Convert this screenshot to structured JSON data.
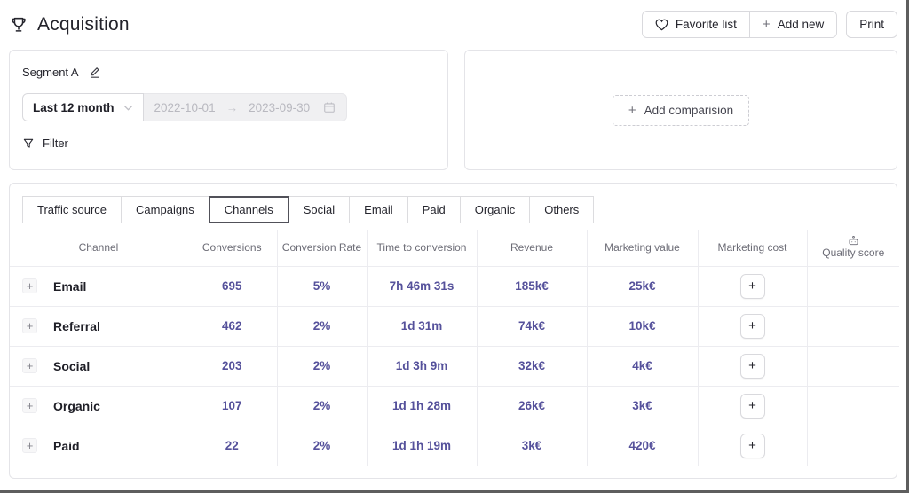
{
  "header": {
    "title": "Acquisition",
    "favorite_label": "Favorite list",
    "add_new_label": "Add new",
    "print_label": "Print"
  },
  "filters": {
    "segment_label": "Segment A",
    "period_value": "Last 12 month",
    "date_start": "2022-10-01",
    "date_arrow": "→",
    "date_end": "2023-09-30",
    "filter_label": "Filter"
  },
  "comparison": {
    "add_label": "Add comparision"
  },
  "tabs": [
    {
      "label": "Traffic source",
      "selected": false
    },
    {
      "label": "Campaigns",
      "selected": false
    },
    {
      "label": "Channels",
      "selected": true
    },
    {
      "label": "Social",
      "selected": false
    },
    {
      "label": "Email",
      "selected": false
    },
    {
      "label": "Paid",
      "selected": false
    },
    {
      "label": "Organic",
      "selected": false
    },
    {
      "label": "Others",
      "selected": false
    }
  ],
  "table": {
    "columns": [
      "Channel",
      "Conversions",
      "Conversion Rate",
      "Time to conversion",
      "Revenue",
      "Marketing value",
      "Marketing cost",
      "Quality score"
    ],
    "rows": [
      {
        "channel": "Email",
        "conversions": "695",
        "conversion_rate": "5%",
        "time_to_conversion": "7h 46m 31s",
        "revenue": "185k€",
        "marketing_value": "25k€"
      },
      {
        "channel": "Referral",
        "conversions": "462",
        "conversion_rate": "2%",
        "time_to_conversion": "1d 31m",
        "revenue": "74k€",
        "marketing_value": "10k€"
      },
      {
        "channel": "Social",
        "conversions": "203",
        "conversion_rate": "2%",
        "time_to_conversion": "1d 3h 9m",
        "revenue": "32k€",
        "marketing_value": "4k€"
      },
      {
        "channel": "Organic",
        "conversions": "107",
        "conversion_rate": "2%",
        "time_to_conversion": "1d 1h 28m",
        "revenue": "26k€",
        "marketing_value": "3k€"
      },
      {
        "channel": "Paid",
        "conversions": "22",
        "conversion_rate": "2%",
        "time_to_conversion": "1d 1h 19m",
        "revenue": "3k€",
        "marketing_value": "420€"
      }
    ]
  },
  "icons": {
    "plus": "+",
    "names": [
      "trophy-icon",
      "heart-icon",
      "plus-icon",
      "chevron-down-icon",
      "calendar-icon",
      "edit-pencil-icon",
      "filter-funnel-icon",
      "robot-icon"
    ]
  },
  "colors": {
    "accent_purple": "#55519b",
    "text_dark": "#26262e",
    "text_gray": "#6c6c76",
    "border_light": "#ececf0",
    "selected_tab_border": "#515159",
    "frame_edge": "#5e5e5e"
  }
}
